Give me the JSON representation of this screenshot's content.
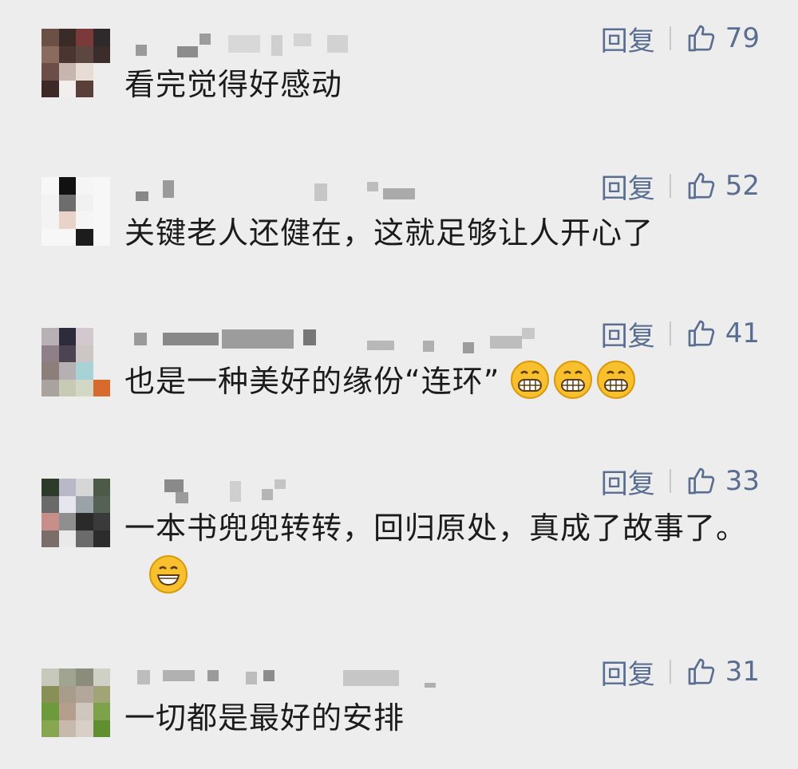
{
  "reply_label": "回复",
  "icons": {
    "like": "thumbs-up-icon",
    "emoji": "grinning-face-emoji"
  },
  "colors": {
    "action": "#5a6e91",
    "text": "#1b1b1b",
    "background": "#ededed"
  },
  "comments": [
    {
      "likes": "79",
      "text": "看完觉得好感动"
    },
    {
      "likes": "52",
      "text": "关键老人还健在，这就足够让人开心了"
    },
    {
      "likes": "41",
      "text": "也是一种美好的缘份“连环”"
    },
    {
      "likes": "33",
      "text": "一本书兜兜转转，回归原处，真成了故事了。"
    },
    {
      "likes": "31",
      "text": "一切都是最好的安排"
    }
  ]
}
